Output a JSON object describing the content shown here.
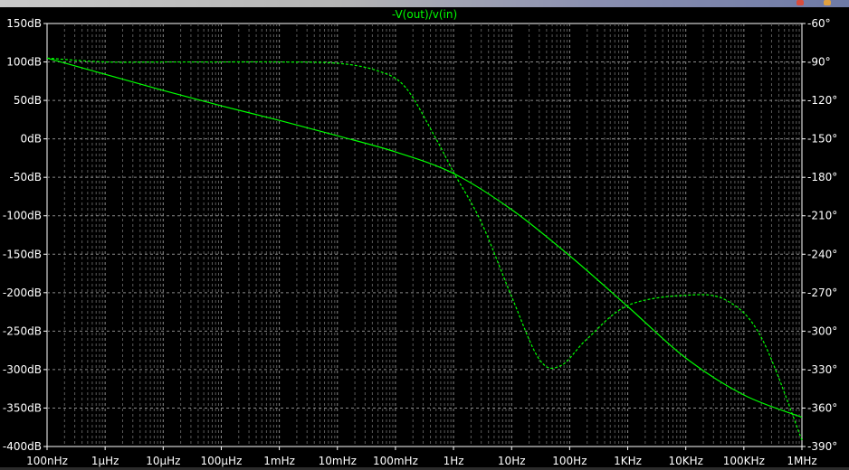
{
  "chart_data": {
    "type": "line",
    "title": "-V(out)/v(in)",
    "x_scale": "log",
    "xlim_hz": [
      1e-07,
      1000000
    ],
    "x_tick_labels": [
      "100nHz",
      "1µHz",
      "10µHz",
      "100µHz",
      "1mHz",
      "10mHz",
      "100mHz",
      "1Hz",
      "10Hz",
      "100Hz",
      "1KHz",
      "10KHz",
      "100KHz",
      "1MHz"
    ],
    "x_tick_values_hz": [
      1e-07,
      1e-06,
      1e-05,
      0.0001,
      0.001,
      0.01,
      0.1,
      1,
      10,
      100,
      1000,
      10000,
      100000,
      1000000
    ],
    "y_left": {
      "unit": "dB",
      "range": [
        -400,
        150
      ],
      "tick_values": [
        150,
        100,
        50,
        0,
        -50,
        -100,
        -150,
        -200,
        -250,
        -300,
        -350,
        -400
      ],
      "tick_labels": [
        "150dB",
        "100dB",
        "50dB",
        "0dB",
        "-50dB",
        "-100dB",
        "-150dB",
        "-200dB",
        "-250dB",
        "-300dB",
        "-350dB",
        "-400dB"
      ]
    },
    "y_right": {
      "unit": "degrees",
      "range": [
        -390,
        -60
      ],
      "tick_values": [
        -60,
        -90,
        -120,
        -150,
        -180,
        -210,
        -240,
        -270,
        -300,
        -330,
        -360,
        -390
      ],
      "tick_labels": [
        "-60°",
        "-90°",
        "-120°",
        "-150°",
        "-180°",
        "-210°",
        "-240°",
        "-270°",
        "-300°",
        "-330°",
        "-360°",
        "-390°"
      ]
    },
    "grid": true,
    "series": [
      {
        "style": "solid",
        "axis": "left",
        "color": "#00ff00",
        "points": [
          [
            1e-07,
            105
          ],
          [
            1e-06,
            84
          ],
          [
            1e-05,
            63
          ],
          [
            0.0001,
            43
          ],
          [
            0.001,
            24
          ],
          [
            0.01,
            4
          ],
          [
            0.1,
            -17
          ],
          [
            1,
            -45
          ],
          [
            10,
            -92
          ],
          [
            100,
            -152
          ],
          [
            1000,
            -218
          ],
          [
            10000,
            -285
          ],
          [
            100000,
            -333
          ],
          [
            1000000,
            -362
          ]
        ]
      },
      {
        "style": "dashed",
        "axis": "right",
        "color": "#00ff00",
        "points": [
          [
            1e-07,
            -87
          ],
          [
            1e-06,
            -90
          ],
          [
            1e-05,
            -90
          ],
          [
            0.0001,
            -90
          ],
          [
            0.001,
            -90
          ],
          [
            0.01,
            -91
          ],
          [
            0.05,
            -97
          ],
          [
            0.15,
            -110
          ],
          [
            0.5,
            -150
          ],
          [
            1,
            -176
          ],
          [
            3,
            -215
          ],
          [
            10,
            -273
          ],
          [
            30,
            -322
          ],
          [
            70,
            -327
          ],
          [
            200,
            -306
          ],
          [
            1000,
            -280
          ],
          [
            10000,
            -272
          ],
          [
            50000,
            -276
          ],
          [
            200000,
            -305
          ],
          [
            1000000,
            -385
          ]
        ]
      }
    ]
  }
}
